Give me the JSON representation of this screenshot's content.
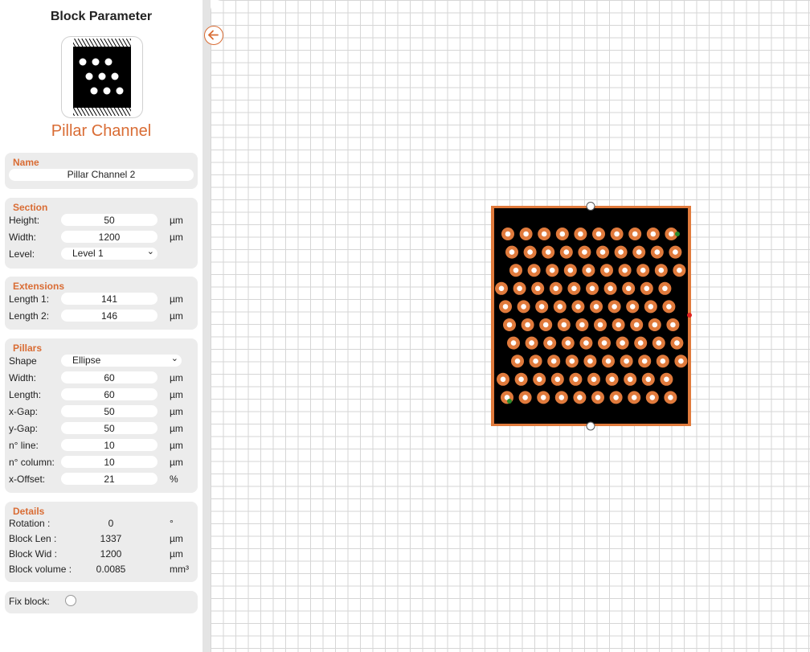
{
  "panel": {
    "title": "Block Parameter",
    "block_type": "Pillar Channel"
  },
  "name": {
    "title": "Name",
    "value": "Pillar Channel 2"
  },
  "section": {
    "title": "Section",
    "height_label": "Height:",
    "height": "50",
    "height_unit": "µm",
    "width_label": "Width:",
    "width": "1200",
    "width_unit": "µm",
    "level_label": "Level:",
    "level": "Level 1"
  },
  "extensions": {
    "title": "Extensions",
    "length1_label": "Length 1:",
    "length1": "141",
    "length1_unit": "µm",
    "length2_label": "Length 2:",
    "length2": "146",
    "length2_unit": "µm"
  },
  "pillars": {
    "title": "Pillars",
    "shape_label": "Shape",
    "shape": "Ellipse",
    "width_label": "Width:",
    "width": "60",
    "width_unit": "µm",
    "length_label": "Length:",
    "length": "60",
    "length_unit": "µm",
    "xgap_label": "x-Gap:",
    "xgap": "50",
    "xgap_unit": "µm",
    "ygap_label": "y-Gap:",
    "ygap": "50",
    "ygap_unit": "µm",
    "nline_label": "n° line:",
    "nline": "10",
    "nline_unit": "µm",
    "ncol_label": "n° column:",
    "ncol": "10",
    "ncol_unit": "µm",
    "xoffset_label": "x-Offset:",
    "xoffset": "21",
    "xoffset_unit": "%"
  },
  "details": {
    "title": "Details",
    "rotation_label": "Rotation :",
    "rotation": "0",
    "rotation_unit": "°",
    "len_label": "Block Len :",
    "len": "1337",
    "len_unit": "µm",
    "wid_label": "Block Wid :",
    "wid": "1200",
    "wid_unit": "µm",
    "vol_label": "Block volume :",
    "vol": "0.0085",
    "vol_unit": "mm³"
  },
  "fix": {
    "label": "Fix block:"
  },
  "colors": {
    "accent": "#d96c34",
    "block_fill": "#000000",
    "pillar": "#e07a3c",
    "connector_green": "#2a8a2a",
    "connector_red": "#e02020"
  },
  "icons": {
    "back": "arrow-left-circle-icon"
  }
}
